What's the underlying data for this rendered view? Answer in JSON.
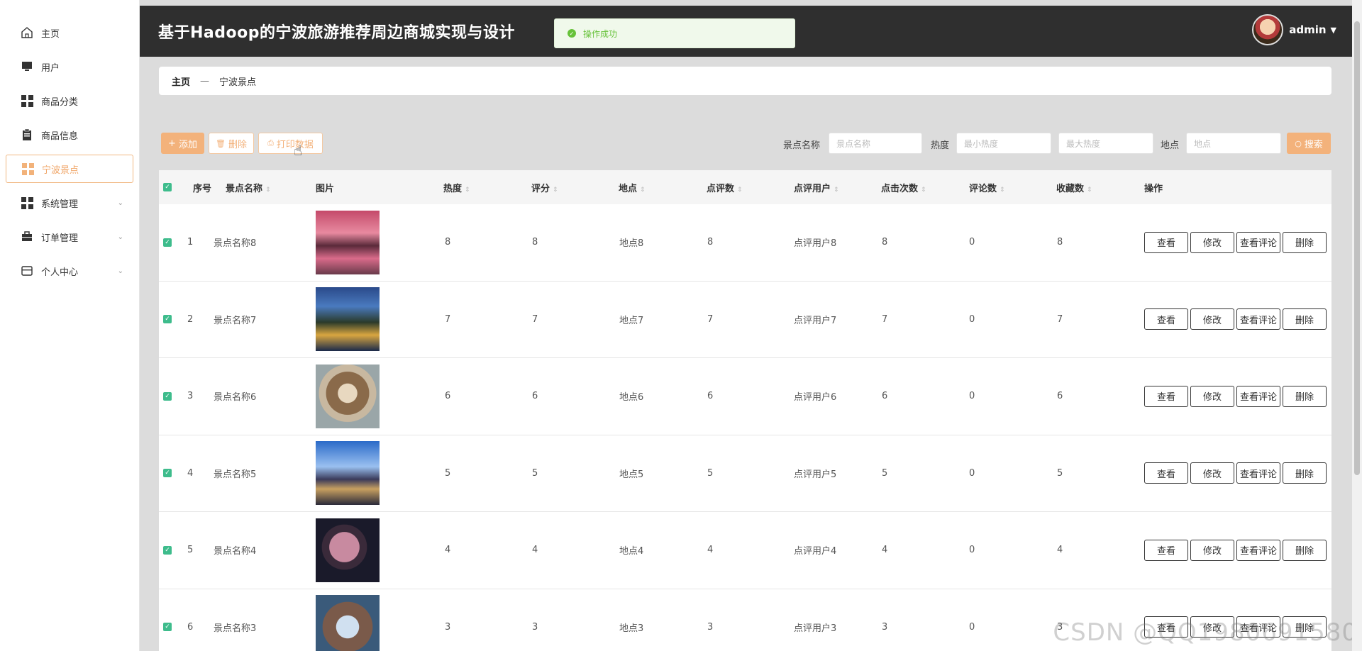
{
  "app": {
    "title": "基于Hadoop的宁波旅游推荐周边商城实现与设计",
    "user": "admin",
    "toast": "操作成功"
  },
  "sidebar": {
    "items": [
      {
        "label": "主页",
        "icon": "home-icon",
        "expandable": false,
        "active": false
      },
      {
        "label": "用户",
        "icon": "monitor-icon",
        "expandable": false,
        "active": false
      },
      {
        "label": "商品分类",
        "icon": "grid-icon",
        "expandable": false,
        "active": false
      },
      {
        "label": "商品信息",
        "icon": "clipboard-icon",
        "expandable": false,
        "active": false
      },
      {
        "label": "宁波景点",
        "icon": "grid-icon",
        "expandable": false,
        "active": true
      },
      {
        "label": "系统管理",
        "icon": "grid-icon",
        "expandable": true,
        "active": false
      },
      {
        "label": "订单管理",
        "icon": "briefcase-icon",
        "expandable": true,
        "active": false
      },
      {
        "label": "个人中心",
        "icon": "card-icon",
        "expandable": true,
        "active": false
      }
    ]
  },
  "breadcrumb": {
    "home": "主页",
    "separator": "—",
    "current": "宁波景点"
  },
  "toolbar": {
    "add": "添加",
    "delete": "删除",
    "print": "打印数据",
    "search": "搜索",
    "filters": {
      "name_label": "景点名称",
      "name_placeholder": "景点名称",
      "heat_label": "热度",
      "heat_min_placeholder": "最小热度",
      "heat_max_placeholder": "最大热度",
      "place_label": "地点",
      "place_placeholder": "地点"
    }
  },
  "table": {
    "columns": [
      "序号",
      "景点名称",
      "图片",
      "热度",
      "评分",
      "地点",
      "点评数",
      "点评用户",
      "点击次数",
      "评论数",
      "收藏数",
      "操作"
    ],
    "actions": [
      "查看",
      "修改",
      "查看评论",
      "删除"
    ],
    "rows": [
      {
        "index": "1",
        "name": "景点名称8",
        "heat": "8",
        "score": "8",
        "place": "地点8",
        "reviews": "8",
        "reviewer": "点评用户8",
        "clicks": "8",
        "comments": "0",
        "favorites": "8"
      },
      {
        "index": "2",
        "name": "景点名称7",
        "heat": "7",
        "score": "7",
        "place": "地点7",
        "reviews": "7",
        "reviewer": "点评用户7",
        "clicks": "7",
        "comments": "0",
        "favorites": "7"
      },
      {
        "index": "3",
        "name": "景点名称6",
        "heat": "6",
        "score": "6",
        "place": "地点6",
        "reviews": "6",
        "reviewer": "点评用户6",
        "clicks": "6",
        "comments": "0",
        "favorites": "6"
      },
      {
        "index": "4",
        "name": "景点名称5",
        "heat": "5",
        "score": "5",
        "place": "地点5",
        "reviews": "5",
        "reviewer": "点评用户5",
        "clicks": "5",
        "comments": "0",
        "favorites": "5"
      },
      {
        "index": "5",
        "name": "景点名称4",
        "heat": "4",
        "score": "4",
        "place": "地点4",
        "reviews": "4",
        "reviewer": "点评用户4",
        "clicks": "4",
        "comments": "0",
        "favorites": "4"
      },
      {
        "index": "6",
        "name": "景点名称3",
        "heat": "3",
        "score": "3",
        "place": "地点3",
        "reviews": "3",
        "reviewer": "点评用户3",
        "clicks": "3",
        "comments": "0",
        "favorites": "3"
      }
    ]
  },
  "watermark": "CSDN @QQ1980691580",
  "colors": {
    "accent": "#f3b27b",
    "header": "#2f2f2f",
    "check": "#3ebc8c",
    "success": "#67c23a"
  }
}
